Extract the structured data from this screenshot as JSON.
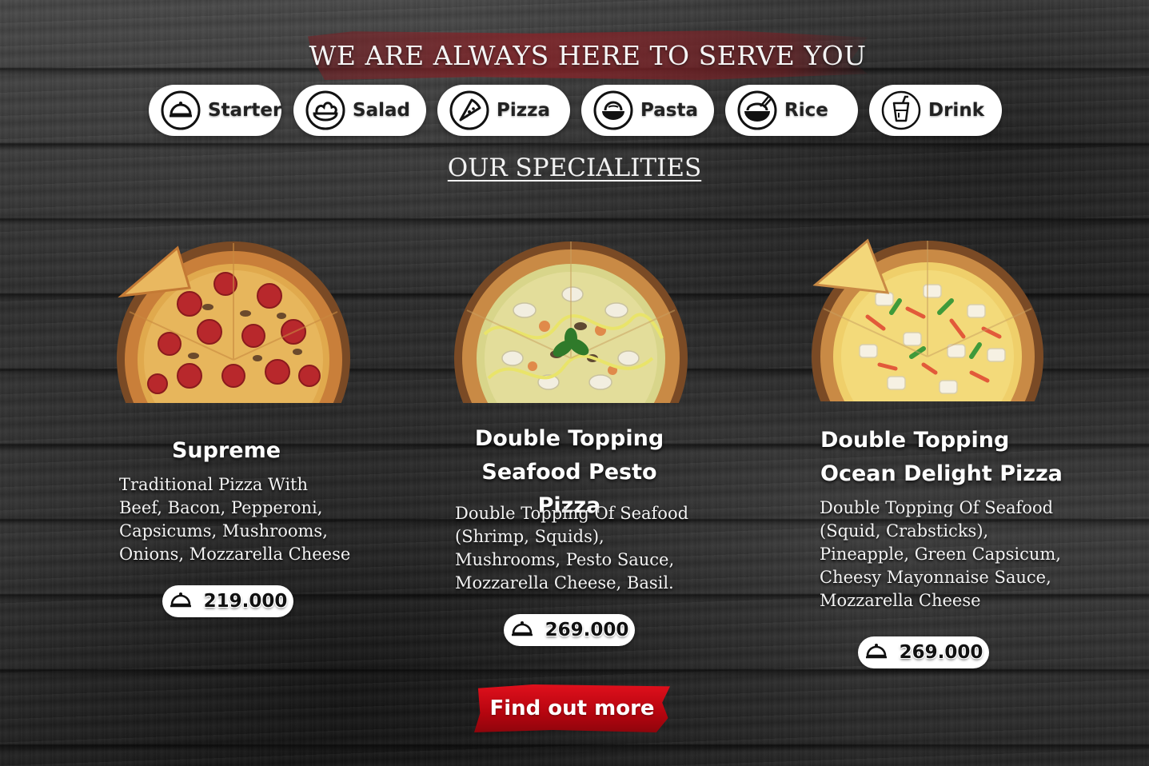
{
  "headline": "WE ARE ALWAYS HERE TO SERVE YOU",
  "categories": [
    {
      "label": "Starter",
      "icon": "cloche-icon"
    },
    {
      "label": "Salad",
      "icon": "salad-bowl-icon"
    },
    {
      "label": "Pizza",
      "icon": "pizza-slice-icon"
    },
    {
      "label": "Pasta",
      "icon": "pasta-bowl-icon"
    },
    {
      "label": "Rice",
      "icon": "rice-bowl-icon"
    },
    {
      "label": "Drink",
      "icon": "drink-cup-icon"
    }
  ],
  "specialities_title": "OUR SPECIALITIES",
  "items": [
    {
      "name_lines": [
        "Supreme"
      ],
      "description_lines": [
        "Traditional Pizza With",
        "Beef, Bacon, Pepperoni,",
        "Capsicums, Mushrooms,",
        "Onions, Mozzarella Cheese"
      ],
      "price": "219.000",
      "price_icon": "cloche-icon"
    },
    {
      "name_lines": [
        "Double Topping",
        "Seafood Pesto Pizza"
      ],
      "description_lines": [
        "Double Topping Of Seafood",
        "(Shrimp, Squids),",
        "Mushrooms, Pesto Sauce,",
        "Mozzarella Cheese, Basil."
      ],
      "price": "269.000",
      "price_icon": "cloche-icon"
    },
    {
      "name_lines": [
        "Double Topping",
        "Ocean Delight Pizza"
      ],
      "description_lines": [
        "Double Topping Of Seafood",
        "(Squid, Crabsticks),",
        "Pineapple, Green Capsicum,",
        "Cheesy Mayonnaise Sauce,",
        "Mozzarella Cheese"
      ],
      "price": "269.000",
      "price_icon": "cloche-icon"
    }
  ],
  "cta_label": "Find out more",
  "colors": {
    "accent_red": "#c8101a",
    "headline_band": "#8c2328",
    "pill_bg": "#ffffff",
    "text_dark": "#222222"
  }
}
